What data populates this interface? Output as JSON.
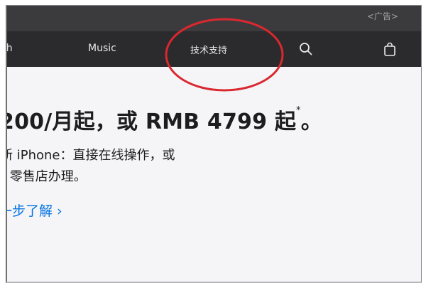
{
  "ad_bar": {
    "label": "<广告>"
  },
  "nav": {
    "items": [
      {
        "label": "ch"
      },
      {
        "label": "Music"
      },
      {
        "label": "技术支持"
      }
    ],
    "icons": [
      "search-icon",
      "bag-icon"
    ]
  },
  "hero": {
    "headline_main": "200/月起，或 RMB 4799 起",
    "headline_asterisk": "*",
    "headline_end": "。",
    "body_line_1": "新 iPhone：直接在线操作，或",
    "body_line_2": "re 零售店办理。",
    "learn_more": "一步了解 ›"
  },
  "colors": {
    "nav_background": "#2b2b2d",
    "ad_background": "#3b3b3d",
    "page_background": "#f5f5f7",
    "link": "#0071e3",
    "annotation_circle": "#d9282f"
  }
}
